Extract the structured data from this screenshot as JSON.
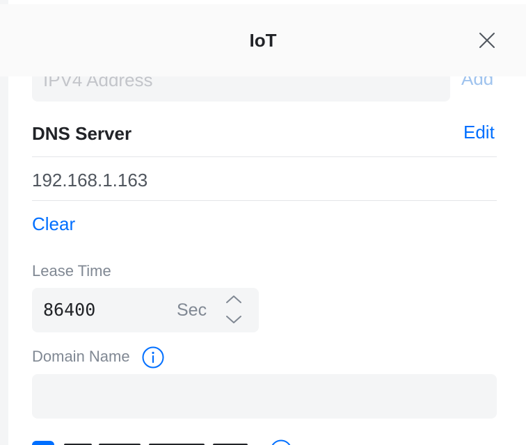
{
  "header": {
    "title": "IoT"
  },
  "ipv4": {
    "placeholder": "IPV4 Address",
    "add_label": "Add"
  },
  "dns": {
    "title": "DNS Server",
    "edit_label": "Edit",
    "value": "192.168.1.163",
    "clear_label": "Clear"
  },
  "lease": {
    "label": "Lease Time",
    "value": "86400",
    "unit": "Sec"
  },
  "domain": {
    "label": "Domain Name",
    "value": ""
  },
  "colors": {
    "accent": "#006fff",
    "accent_disabled": "#9fc3ee",
    "input_bg": "#f4f5f6",
    "label": "#808893",
    "text": "#212327"
  },
  "icons": {
    "close": "close-icon",
    "stepper_up": "chevron-up-icon",
    "stepper_down": "chevron-down-icon",
    "info": "info-icon",
    "checkbox": "checkbox-checked"
  }
}
